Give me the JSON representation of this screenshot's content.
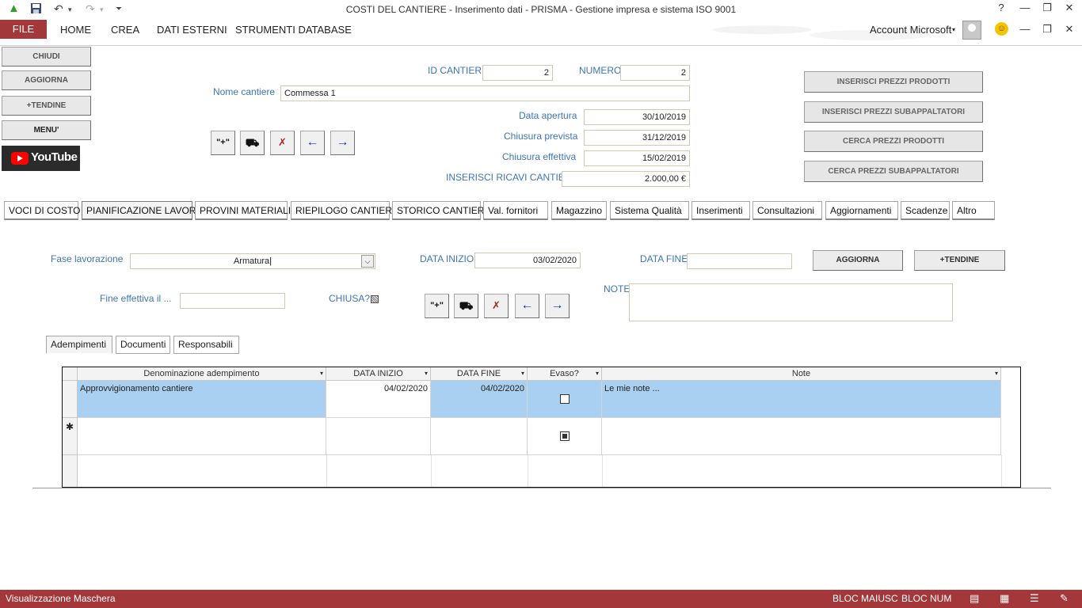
{
  "window": {
    "title": "COSTI DEL CANTIERE - Inserimento dati - PRISMA - Gestione impresa e sistema ISO 9001",
    "help": "?",
    "restore_icon": "restore-icon",
    "account": "Account Microsoft"
  },
  "ribbon": {
    "file": "FILE",
    "tabs": [
      "HOME",
      "CREA",
      "DATI ESTERNI",
      "STRUMENTI DATABASE"
    ]
  },
  "sidebar": {
    "close": "CHIUDI",
    "refresh": "AGGIORNA",
    "dropdowns": "+TENDINE",
    "menu": "MENU'",
    "youtube": "YouTube"
  },
  "header": {
    "id_label": "ID CANTIERE",
    "id_value": "2",
    "numero_label": "NUMERO",
    "numero_value": "2",
    "nome_label": "Nome cantiere",
    "nome_value": "Commessa 1",
    "apertura_label": "Data apertura",
    "apertura_value": "30/10/2019",
    "prevista_label": "Chiusura prevista",
    "prevista_value": "31/12/2019",
    "effettiva_label": "Chiusura effettiva",
    "effettiva_value": "15/02/2019",
    "ricavi_label": "INSERISCI RICAVI CANTIERE",
    "ricavi_value": "2.000,00 €"
  },
  "right_buttons": [
    "INSERISCI PREZZI PRODOTTI",
    "INSERISCI PREZZI SUBAPPALTATORI",
    "CERCA PREZZI PRODOTTI",
    "CERCA PREZZI SUBAPPALTATORI"
  ],
  "nav_icons": [
    "new-record-icon",
    "find-binoculars-icon",
    "delete-record-icon",
    "previous-arrow-icon",
    "next-arrow-icon"
  ],
  "nav_glyphs": {
    "new": "\"+\"",
    "find": "⛟",
    "delete": "✗",
    "prev": "←",
    "next": "→"
  },
  "module_tabs": [
    "VOCI DI COSTO",
    "PIANIFICAZIONE LAVORI",
    "PROVINI MATERIALI",
    "RIEPILOGO CANTIERE",
    "STORICO CANTIERI",
    "Val. fornitori",
    "Magazzino",
    "Sistema Qualità",
    "Inserimenti",
    "Consultazioni",
    "Aggiornamenti",
    "Scadenze",
    "Altro"
  ],
  "module_tab_active": "PIANIFICAZIONE LAVORI",
  "planning": {
    "fase_label": "Fase lavorazione",
    "fase_value": "Armatura",
    "data_inizio_label": "DATA INIZIO",
    "data_inizio_value": "03/02/2020",
    "data_fine_label": "DATA FINE",
    "data_fine_value": "",
    "aggiorna": "AGGIORNA",
    "tendine": "+TENDINE",
    "fine_eff_label": "Fine effettiva il ...",
    "fine_eff_value": "",
    "chiusa_label": "CHIUSA?",
    "note_label": "NOTE",
    "note_value": ""
  },
  "sub_tabs": [
    "Adempimenti",
    "Documenti",
    "Responsabili"
  ],
  "sub_tab_active": "Adempimenti",
  "grid": {
    "columns": [
      "Denominazione adempimento",
      "DATA INIZIO",
      "DATA FINE",
      "Evaso?",
      "Note"
    ],
    "rows": [
      {
        "denominazione": "Approvvigionamento cantiere",
        "data_inizio": "04/02/2020",
        "data_fine": "04/02/2020",
        "evaso": false,
        "note": "Le mie note ..."
      }
    ],
    "new_row_marker": "✱"
  },
  "status": {
    "view": "Visualizzazione Maschera",
    "caps": "BLOC MAIUSC",
    "num": "BLOC NUM"
  }
}
